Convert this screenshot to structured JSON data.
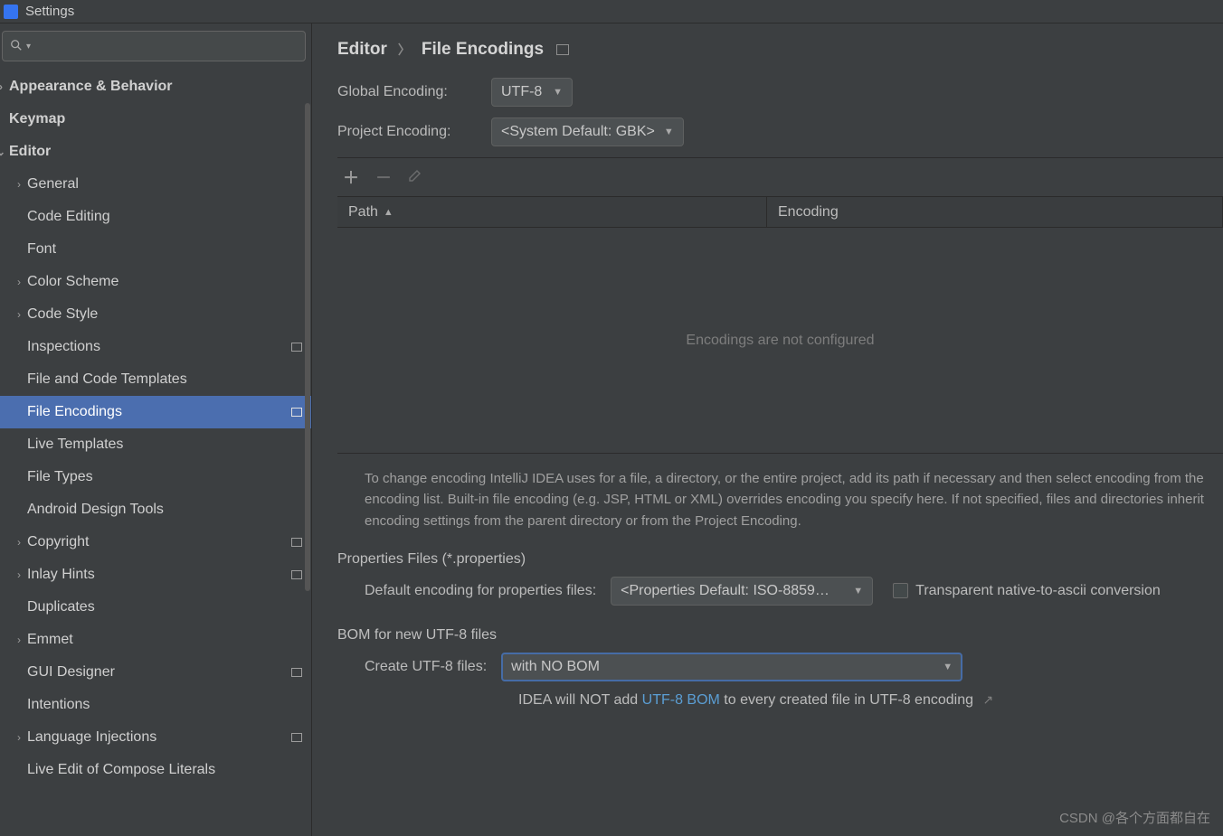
{
  "window": {
    "title": "Settings"
  },
  "search": {
    "placeholder": ""
  },
  "tree": [
    {
      "label": "Appearance & Behavior",
      "level": 0,
      "chev": "right",
      "bold": true
    },
    {
      "label": "Keymap",
      "level": 0,
      "bold": true
    },
    {
      "label": "Editor",
      "level": 0,
      "chev": "down",
      "bold": true
    },
    {
      "label": "General",
      "level": 1,
      "chev": "right"
    },
    {
      "label": "Code Editing",
      "level": 1
    },
    {
      "label": "Font",
      "level": 1
    },
    {
      "label": "Color Scheme",
      "level": 1,
      "chev": "right"
    },
    {
      "label": "Code Style",
      "level": 1,
      "chev": "right"
    },
    {
      "label": "Inspections",
      "level": 1,
      "proj": true
    },
    {
      "label": "File and Code Templates",
      "level": 1
    },
    {
      "label": "File Encodings",
      "level": 1,
      "selected": true,
      "proj": true
    },
    {
      "label": "Live Templates",
      "level": 1
    },
    {
      "label": "File Types",
      "level": 1
    },
    {
      "label": "Android Design Tools",
      "level": 1
    },
    {
      "label": "Copyright",
      "level": 1,
      "chev": "right",
      "proj": true
    },
    {
      "label": "Inlay Hints",
      "level": 1,
      "chev": "right",
      "proj": true
    },
    {
      "label": "Duplicates",
      "level": 1
    },
    {
      "label": "Emmet",
      "level": 1,
      "chev": "right"
    },
    {
      "label": "GUI Designer",
      "level": 1,
      "proj": true
    },
    {
      "label": "Intentions",
      "level": 1
    },
    {
      "label": "Language Injections",
      "level": 1,
      "chev": "right",
      "proj": true
    },
    {
      "label": "Live Edit of Compose Literals",
      "level": 1
    }
  ],
  "breadcrumb": {
    "root": "Editor",
    "leaf": "File Encodings"
  },
  "global": {
    "label": "Global Encoding:",
    "value": "UTF-8"
  },
  "project": {
    "label": "Project Encoding:",
    "value": "<System Default: GBK>"
  },
  "table": {
    "path_header": "Path",
    "encoding_header": "Encoding",
    "empty_text": "Encodings are not configured"
  },
  "help_text": "To change encoding IntelliJ IDEA uses for a file, a directory, or the entire project, add its path if necessary and then select encoding from the encoding list. Built-in file encoding (e.g. JSP, HTML or XML) overrides encoding you specify here. If not specified, files and directories inherit encoding settings from the parent directory or from the Project Encoding.",
  "properties": {
    "section": "Properties Files (*.properties)",
    "label": "Default encoding for properties files:",
    "value": "<Properties Default: ISO-8859…",
    "checkbox_label": "Transparent native-to-ascii conversion"
  },
  "bom": {
    "section": "BOM for new UTF-8 files",
    "label": "Create UTF-8 files:",
    "value": "with NO BOM",
    "note_prefix": "IDEA will NOT add ",
    "note_link": "UTF-8 BOM",
    "note_suffix": " to every created file in UTF-8 encoding"
  },
  "watermark": "CSDN @各个方面都自在"
}
